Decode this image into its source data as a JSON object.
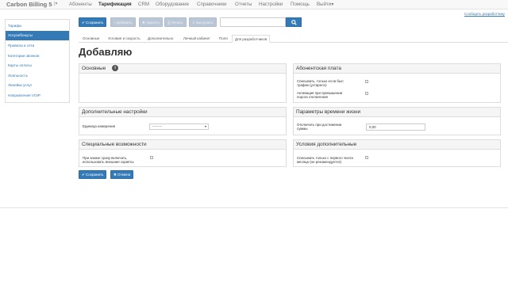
{
  "navbar": {
    "brand": "Carbon Billing 5",
    "brand_caret": "|▾",
    "items": [
      "Абоненты",
      "Тарификация",
      "CRM",
      "Оборудование",
      "Справочники",
      "Отчеты",
      "Настройки",
      "Помощь",
      "Выйти▾"
    ]
  },
  "sidebar": {
    "items": [
      "Тарифы",
      "Услуги/бонусы",
      "Правила и сети",
      "Категории звонков",
      "Карты оплаты",
      "Лояльность",
      "Линейки услуг",
      "Направления VOIP"
    ]
  },
  "help_link": "Сообщить разработчику",
  "toolbar": {
    "save": "✔ Сохранить",
    "add": "+ Добавить",
    "delete": "✖ Удалить",
    "print": "⎙ Печать",
    "export": "⇩ Выгрузить",
    "search_placeholder": "",
    "search_icon": "search-icon"
  },
  "tabs": [
    "Основные",
    "Условия и скорость",
    "Дополнительно",
    "Личный кабинет",
    "Поля",
    "Для разработчиков"
  ],
  "page_title": "Добавляю",
  "panels": {
    "main": {
      "title": "Основные",
      "info": "i"
    },
    "extra_settings": {
      "title": "Дополнительные настройки",
      "unit_label": "Единица измерения",
      "unit_value": "---------"
    },
    "special": {
      "title": "Специальные возможности",
      "option_label": "При заказе сразу включать, использовать внешние скрипты"
    },
    "subscription_fee": {
      "title": "Абонентская плата",
      "option1_label": "Списывать, только если был трафик (устарело)",
      "option2_label": "Активация при превышении порога отключения"
    },
    "lifetime": {
      "title": "Параметры времени жизни",
      "field_label": "Отключить при достижении суммы",
      "field_value": "0,00"
    },
    "additional_conditions": {
      "title": "Условия дополнительные",
      "option_label": "Списывать только с первого числа месяца (не рекомендуется)"
    }
  },
  "bottom_buttons": {
    "save": "✔ Сохранить",
    "cancel": "✖ Отмена"
  },
  "colors": {
    "primary": "#337ab7",
    "disabled": "#b9c7d6",
    "panel_heading": "#f5f5f5"
  }
}
